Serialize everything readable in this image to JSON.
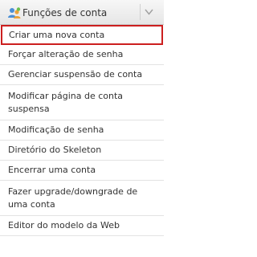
{
  "header": {
    "title": "Funções de conta",
    "icon": "account-roles-icon",
    "collapse_icon": "chevron-down-icon"
  },
  "colors": {
    "selection_outline": "#cc1f1f",
    "header_bg": "#ececec",
    "text": "#333333"
  },
  "menu": {
    "items": [
      {
        "label": "Criar uma nova conta",
        "selected": true
      },
      {
        "label": "Forçar alteração de senha"
      },
      {
        "label": "Gerenciar suspensão de conta"
      },
      {
        "label": "Modificar página de conta suspensa"
      },
      {
        "label": "Modificação de senha"
      },
      {
        "label": "Diretório do Skeleton"
      },
      {
        "label": "Encerrar uma conta"
      },
      {
        "label": "Fazer upgrade/downgrade de uma conta"
      },
      {
        "label": "Editor do modelo da Web"
      }
    ]
  }
}
